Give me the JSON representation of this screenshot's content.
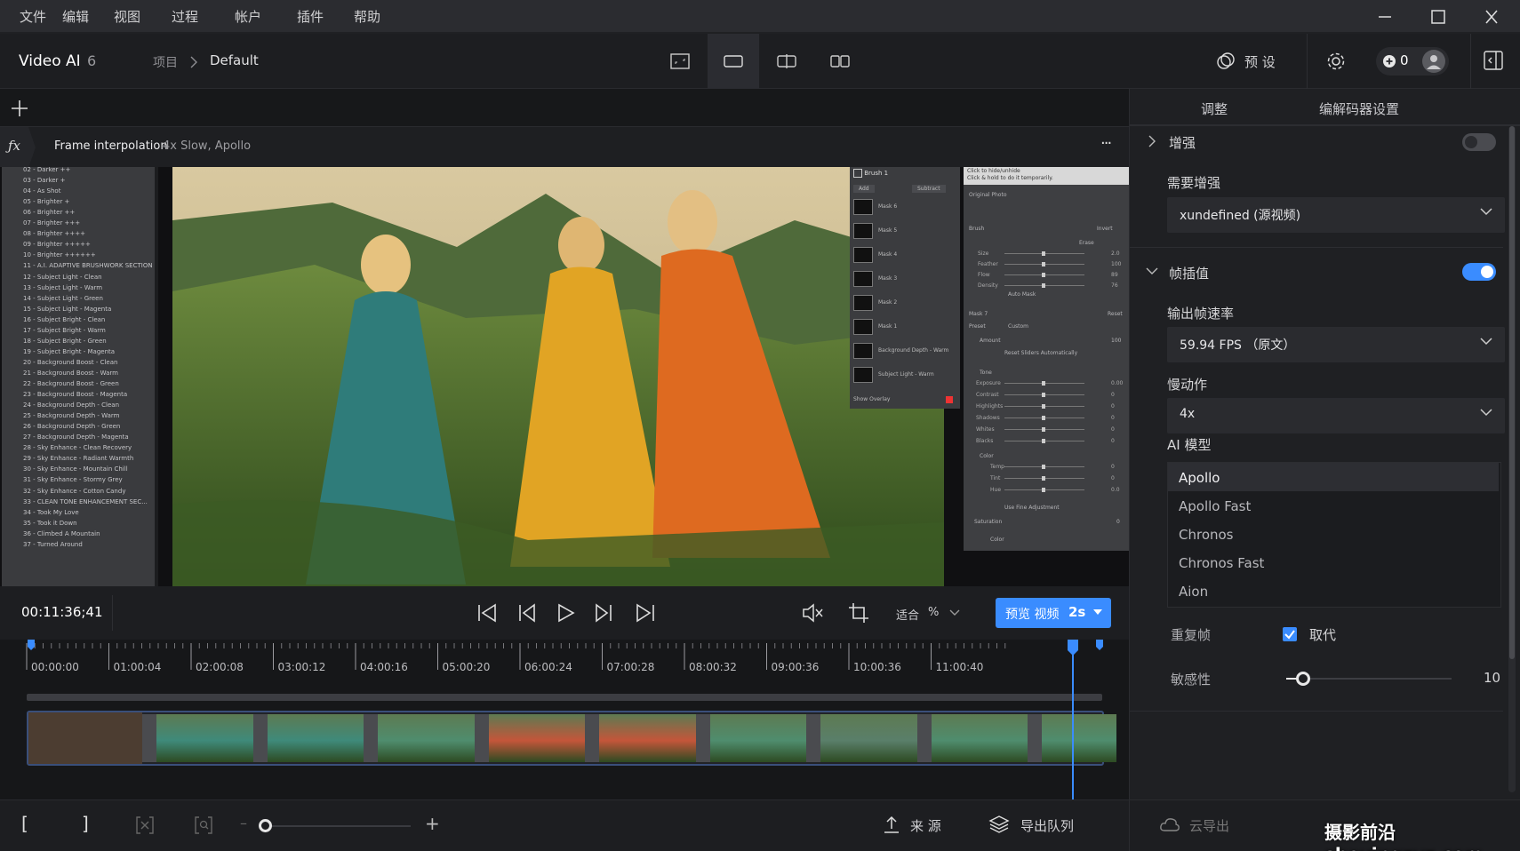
{
  "menu": [
    "文件",
    "编辑",
    "视图",
    "过程",
    "帐户",
    "插件",
    "帮助"
  ],
  "header": {
    "app_name": "Video AI",
    "app_version": "6",
    "breadcrumb_root": "项目",
    "breadcrumb_current": "Default",
    "presets_label": "预 设",
    "credits_count": "0"
  },
  "fxbar": {
    "filter_name": "Frame interpolation",
    "filter_details": "4x Slow, Apollo",
    "more_label": "···"
  },
  "viewer_overlay": {
    "preset_list": [
      "02 - Darker ++",
      "03 - Darker +",
      "04 - As Shot",
      "05 - Brighter +",
      "06 - Brighter ++",
      "07 - Brighter +++",
      "08 - Brighter ++++",
      "09 - Brighter +++++",
      "10 - Brighter ++++++",
      "11 - A.I. ADAPTIVE BRUSHWORK SECTION",
      "12 - Subject Light - Clean",
      "13 - Subject Light - Warm",
      "14 - Subject Light - Green",
      "15 - Subject Light - Magenta",
      "16 - Subject Bright - Clean",
      "17 - Subject Bright - Warm",
      "18 - Subject Bright - Green",
      "19 - Subject Bright - Magenta",
      "20 - Background Boost - Clean",
      "21 - Background Boost - Warm",
      "22 - Background Boost - Green",
      "23 - Background Boost - Magenta",
      "24 - Background Depth - Clean",
      "25 - Background Depth - Warm",
      "26 - Background Depth - Green",
      "27 - Background Depth - Magenta",
      "28 - Sky Enhance - Clean Recovery",
      "29 - Sky Enhance - Radiant Warmth",
      "30 - Sky Enhance - Mountain Chill",
      "31 - Sky Enhance - Stormy Grey",
      "32 - Sky Enhance - Cotton Candy",
      "33 - CLEAN TONE ENHANCEMENT SEC...",
      "34 - Took My Love",
      "35 - Took it Down",
      "36 - Climbed A Mountain",
      "37 - Turned Around"
    ],
    "masks": [
      "Mask 6",
      "Mask 5",
      "Mask 4",
      "Mask 3",
      "Mask 2",
      "Mask 1",
      "Background Depth - Warm",
      "Subject Light - Warm"
    ],
    "brush_title": "Brush 1",
    "add_label": "Add",
    "subtract_label": "Subtract",
    "show_overlay": "Show Overlay",
    "tooltip_1": "Click to hide/unhide",
    "tooltip_2": "Click & hold to do it temporarily.",
    "original_photo": "Original Photo",
    "brush_section": "Brush",
    "invert_label": "Invert",
    "erase_label": "Erase",
    "brush_sliders": [
      {
        "name": "Size",
        "value": "2.0"
      },
      {
        "name": "Feather",
        "value": "100"
      },
      {
        "name": "Flow",
        "value": "89"
      },
      {
        "name": "Density",
        "value": "76"
      }
    ],
    "auto_mask": "Auto Mask",
    "mask7_title": "Mask 7",
    "reset_label": "Reset",
    "preset_label": "Preset",
    "preset_value": "Custom",
    "amount_label": "Amount",
    "amount_value": "100",
    "reset_sliders": "Reset Sliders Automatically",
    "tone_title": "Tone",
    "tone_sliders": [
      {
        "name": "Exposure",
        "value": "0.00"
      },
      {
        "name": "Contrast",
        "value": "0"
      },
      {
        "name": "Highlights",
        "value": "0"
      },
      {
        "name": "Shadows",
        "value": "0"
      },
      {
        "name": "Whites",
        "value": "0"
      },
      {
        "name": "Blacks",
        "value": "0"
      }
    ],
    "color_title": "Color",
    "color_sliders": [
      {
        "name": "Temp",
        "value": "0"
      },
      {
        "name": "Tint",
        "value": "0"
      },
      {
        "name": "Hue",
        "value": "0.0"
      }
    ],
    "fine_adjust": "Use Fine Adjustment",
    "saturation_label": "Saturation",
    "saturation_value": "0",
    "color_label": "Color"
  },
  "transport": {
    "timecode": "00:11:36;41",
    "fit_label": "适合",
    "fit_unit": "%",
    "preview_label": "预览 视频",
    "preview_duration": "2s"
  },
  "timeline": {
    "ticks": [
      "00:00:00",
      "01:00:04",
      "02:00:08",
      "03:00:12",
      "04:00:16",
      "05:00:20",
      "06:00:24",
      "07:00:28",
      "08:00:32",
      "09:00:36",
      "10:00:36",
      "11:00:40"
    ]
  },
  "right_panel": {
    "tab_adjust": "调整",
    "tab_codec": "编解码器设置",
    "enhance_label": "增强",
    "enhance_on": false,
    "need_enhance_label": "需要增强",
    "need_enhance_value": "xundefined (源视频)",
    "frame_interp_label": "帧插值",
    "frame_interp_on": true,
    "output_fps_label": "输出帧速率",
    "output_fps_value": "59.94 FPS （原文）",
    "slowmo_label": "慢动作",
    "slowmo_value": "4x",
    "ai_model_label": "AI 模型",
    "models": [
      "Apollo",
      "Apollo Fast",
      "Chronos",
      "Chronos Fast",
      "Aion"
    ],
    "selected_model": "Apollo",
    "dup_frames_label": "重复帧",
    "replace_label": "取代",
    "replace_checked": true,
    "sensitivity_label": "敏感性",
    "sensitivity_value": "10",
    "sensitivity_fraction": 0.1
  },
  "bottom": {
    "source_label": "来 源",
    "export_queue_label": "导出队列",
    "cloud_export_label": "云导出"
  },
  "watermark": "摄影前沿 sheyingzyz.com",
  "colors": {
    "accent": "#3a8cff",
    "toggle_off": "#4a4b50"
  }
}
